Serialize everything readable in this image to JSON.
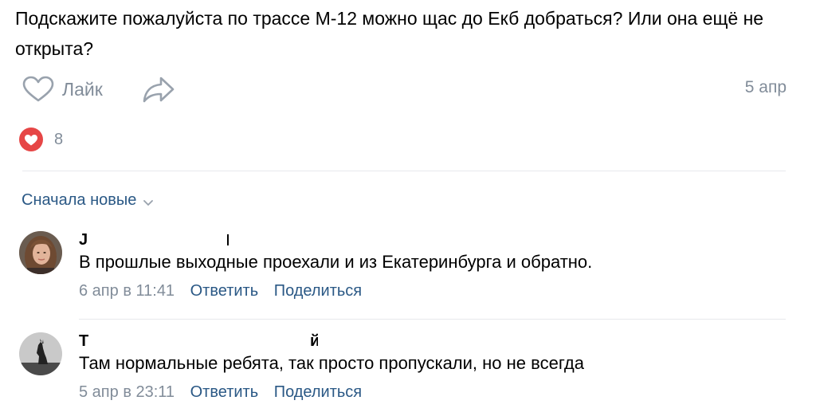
{
  "post": {
    "text": "Подскажите пожалуйста по трассе М-12 можно щас до Екб добраться? Или она ещё не открыта?",
    "like_label": "Лайк",
    "date": "5 апр",
    "likes_count": "8"
  },
  "comments": {
    "sort_label": "Сначала новые",
    "items": [
      {
        "author": "J",
        "text": "В прошлые выходные проехали и из Екатеринбурга и обратно.",
        "date": "6 апр в 11:41",
        "reply_label": "Ответить",
        "share_label": "Поделиться"
      },
      {
        "author": "Т",
        "author_tail": "й",
        "text": "Там нормальные ребята, так просто пропускали, но не всегда",
        "date": "5 апр в 23:11",
        "reply_label": "Ответить",
        "share_label": "Поделиться"
      }
    ]
  },
  "colors": {
    "muted": "#818c99",
    "link": "#2a5885",
    "like_red": "#e64646",
    "divider": "#e7e8ec"
  },
  "icons": [
    "heart-outline-icon",
    "share-arrow-icon",
    "heart-filled-icon",
    "chevron-down-icon"
  ]
}
